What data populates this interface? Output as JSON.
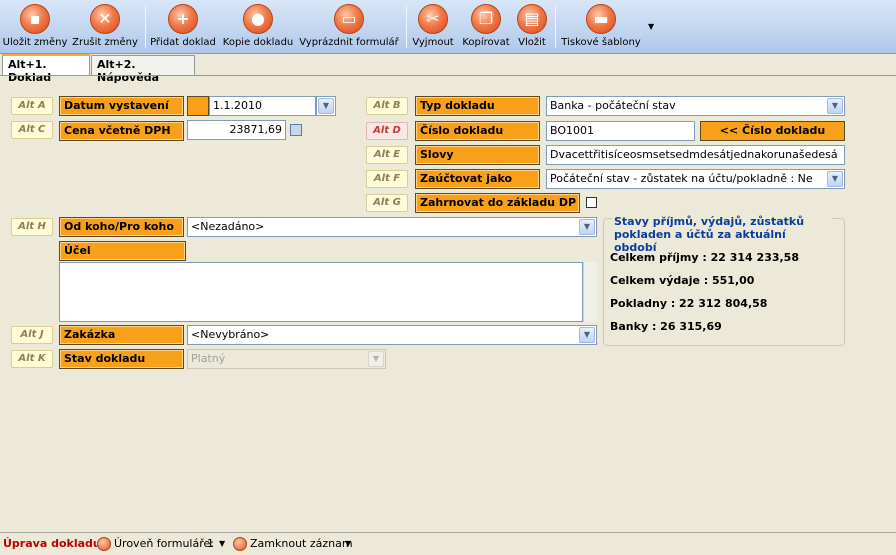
{
  "toolbar": {
    "save": "Uložit změny",
    "cancel": "Zrušit změny",
    "add": "Přidat doklad",
    "copy_doc": "Kopie dokladu",
    "clear_form": "Vyprázdnit formulář",
    "cut": "Vyjmout",
    "copy": "Kopírovat",
    "paste": "Vložit",
    "print_templates": "Tiskové šablony"
  },
  "tabs": [
    "Alt+1. Doklad",
    "Alt+2. Nápověda"
  ],
  "form": {
    "alt_a": "Alt A",
    "alt_b": "Alt B",
    "alt_c": "Alt C",
    "alt_d": "Alt D",
    "alt_e": "Alt E",
    "alt_f": "Alt F",
    "alt_g": "Alt G",
    "alt_h": "Alt H",
    "alt_j": "Alt J",
    "alt_k": "Alt K",
    "date_label": "Datum vystavení",
    "date_value": "1.1.2010",
    "price_label": "Cena včetně DPH",
    "price_value": "23871,69",
    "doc_type_label": "Typ dokladu",
    "doc_type_value": "Banka - počáteční stav",
    "doc_number_label": "Číslo dokladu",
    "doc_number_value": "BO1001",
    "doc_number_button": "<< Číslo dokladu",
    "words_label": "Slovy",
    "words_value": "Dvacettřitisíceosmsetsedmdesátjednakorunašedesá",
    "account_as_label": "Zaúčtovat jako",
    "account_as_value": "Počáteční stav - zůstatek na účtu/pokladně : Ne",
    "include_tax_label": "Zahrnovat do základu DP",
    "from_to_label": "Od koho/Pro koho",
    "from_to_value": "<Nezadáno>",
    "purpose_label": "Účel",
    "order_label": "Zakázka",
    "order_value": "<Nevybráno>",
    "status_label": "Stav dokladu",
    "status_value": "Platný"
  },
  "summary": {
    "title": "Stavy příjmů, výdajů, zůstatků pokladen a účtů za aktuální období",
    "income": "Celkem příjmy : 22 314 233,58",
    "expenses": "Celkem výdaje : 551,00",
    "cash": "Pokladny : 22 312 804,58",
    "banks": "Banky : 26 315,69"
  },
  "statusbar": {
    "title": "Úprava dokladu",
    "form_level": "Úroveň formuláře:",
    "form_level_value": "1",
    "lock_record": "Zamknout záznam"
  },
  "colors": {
    "label_orange": "#f9a01b",
    "summary_title_blue": "#0a3c9c",
    "status_red": "#c00000"
  }
}
